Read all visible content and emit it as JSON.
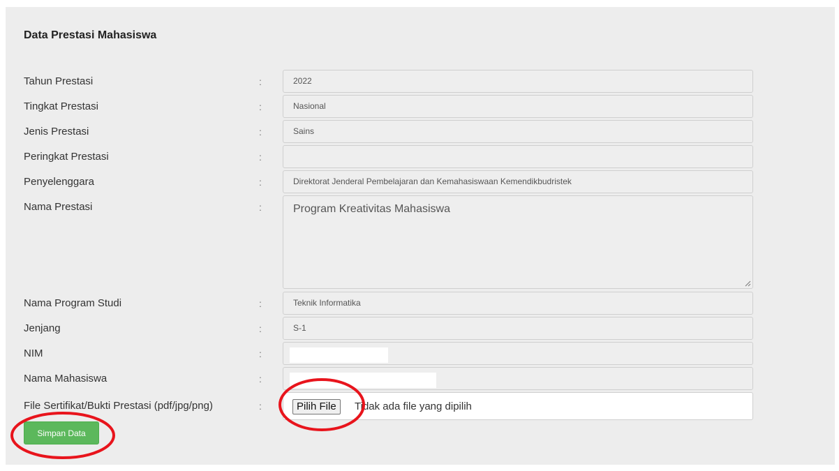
{
  "form": {
    "title": "Data Prestasi Mahasiswa",
    "fields": [
      {
        "label": "Tahun Prestasi",
        "value": "2022"
      },
      {
        "label": "Tingkat Prestasi",
        "value": "Nasional"
      },
      {
        "label": "Jenis Prestasi",
        "value": "Sains"
      },
      {
        "label": "Peringkat Prestasi",
        "value": ""
      },
      {
        "label": "Penyelenggara",
        "value": "Direktorat Jenderal Pembelajaran dan Kemahasiswaan Kemendikbudristek"
      },
      {
        "label": "Nama Prestasi",
        "value": "Program Kreativitas Mahasiswa"
      },
      {
        "label": "Nama Program Studi",
        "value": "Teknik Informatika"
      },
      {
        "label": "Jenjang",
        "value": "S-1"
      },
      {
        "label": "NIM",
        "value": ""
      },
      {
        "label": "Nama Mahasiswa",
        "value": ""
      },
      {
        "label": "File Sertifikat/Bukti Prestasi (pdf/jpg/png)"
      }
    ],
    "separator": ":",
    "file_button_label": "Pilih File",
    "file_status": "Tidak ada file yang dipilih",
    "save_button_label": "Simpan Data"
  },
  "colors": {
    "panel_background": "#ededed",
    "field_background": "#eeeeee",
    "save_button": "#5cb85c",
    "annotation_circle": "#e8141c"
  }
}
